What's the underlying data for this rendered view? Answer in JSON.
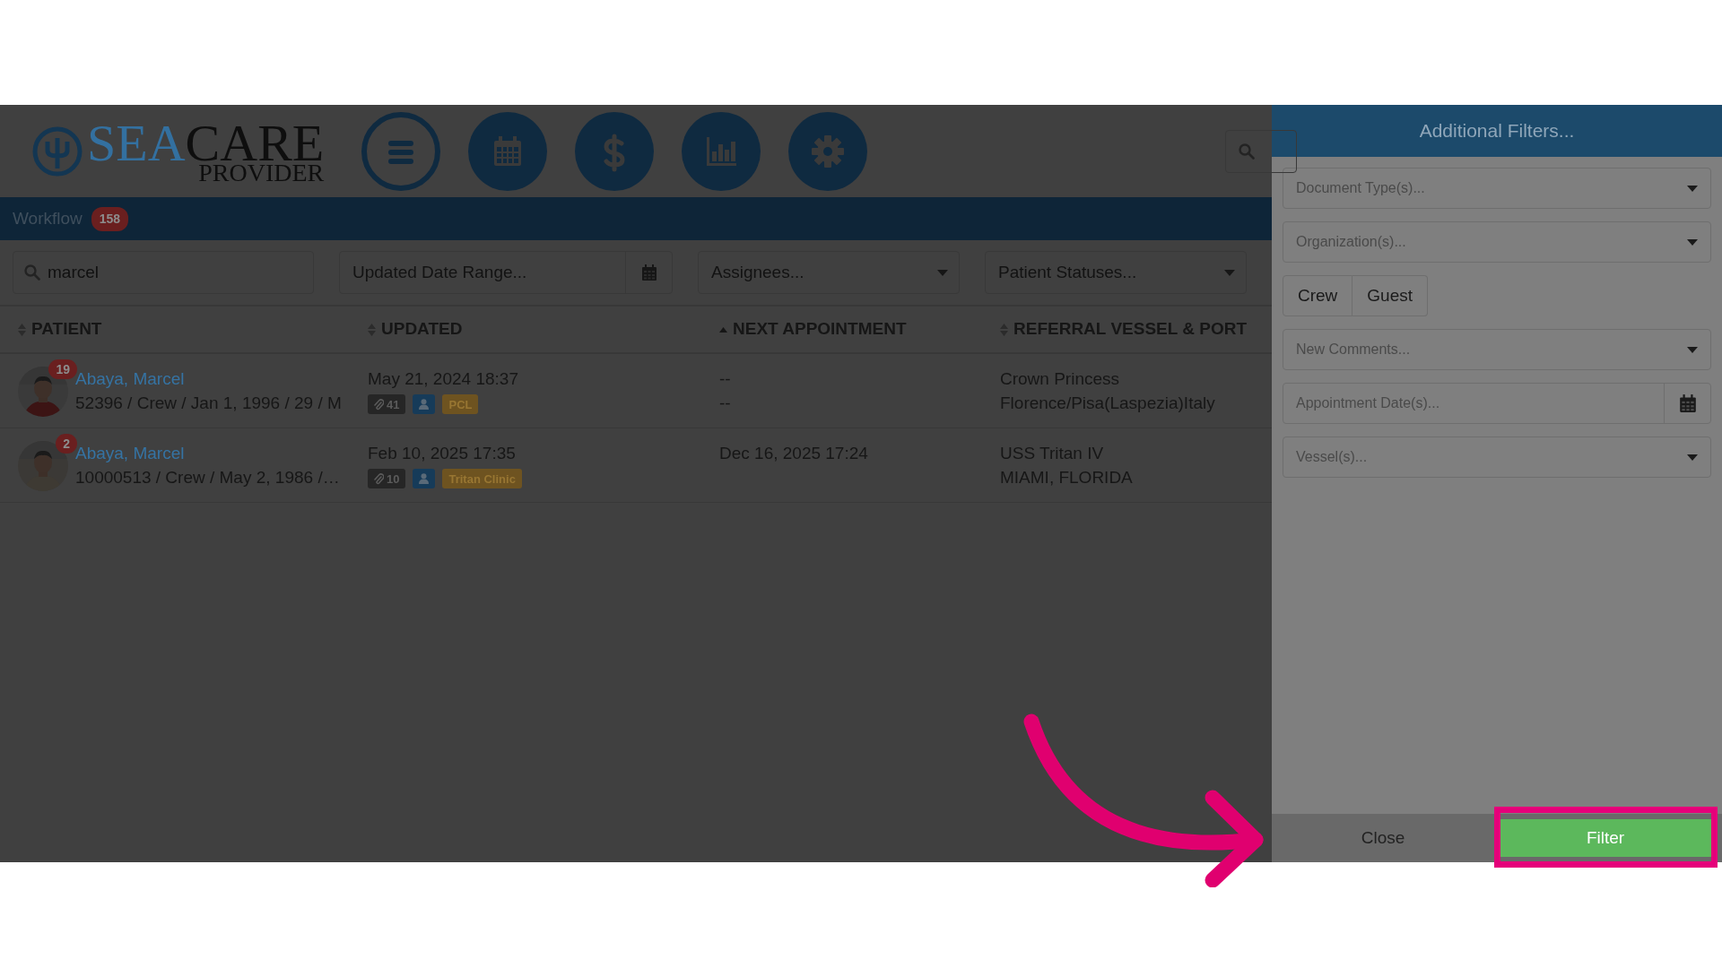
{
  "logo": {
    "primary": "SEA",
    "secondary": "CARE",
    "subtitle": "PROVIDER"
  },
  "nav": [
    {
      "selected": true
    },
    {
      "selected": false
    },
    {
      "selected": false
    },
    {
      "selected": false
    },
    {
      "selected": false
    }
  ],
  "workflow": {
    "label": "Workflow",
    "count": "158"
  },
  "filters": {
    "search": {
      "value": "marcel"
    },
    "date_range": {
      "placeholder": "Updated Date Range..."
    },
    "assignees": {
      "placeholder": "Assignees..."
    },
    "statuses": {
      "placeholder": "Patient Statuses..."
    }
  },
  "table": {
    "columns": [
      {
        "label": "PATIENT",
        "sorted": false
      },
      {
        "label": "UPDATED",
        "sorted": false
      },
      {
        "label": "NEXT APPOINTMENT",
        "sorted": true
      },
      {
        "label": "REFERRAL VESSEL & PORT",
        "sorted": false
      }
    ],
    "rows": [
      {
        "name": "Abaya, Marcel",
        "count": "19",
        "details": "52396 / Crew / Jan 1, 1996 / 29 / M",
        "updated": "May 21, 2024 18:37",
        "attachments": "41",
        "tag": "PCL",
        "appointment": [
          "--",
          "--"
        ],
        "vessel": "Crown Princess",
        "port": "Florence/Pisa(Laspezia)Italy",
        "avatar": {
          "kind": "picture"
        }
      },
      {
        "name": "Abaya, Marcel",
        "count": "2",
        "details": "10000513 / Crew / May 2, 1986 /…",
        "updated": "Feb 10, 2025 17:35",
        "attachments": "10",
        "tag": "Tritan Clinic",
        "appointment": [
          "Dec 16, 2025 17:24"
        ],
        "vessel": "USS Tritan IV",
        "port": "MIAMI, FLORIDA",
        "avatar": {
          "kind": "picture"
        }
      }
    ]
  },
  "panel": {
    "title": "Additional Filters...",
    "fields": [
      {
        "kind": "select",
        "placeholder": "Document Type(s)..."
      },
      {
        "kind": "select",
        "placeholder": "Organization(s)..."
      },
      {
        "kind": "toggle",
        "options": [
          {
            "label": "Crew",
            "selected": false
          },
          {
            "label": "Guest",
            "selected": false
          }
        ]
      },
      {
        "kind": "select",
        "placeholder": "New Comments..."
      },
      {
        "kind": "date",
        "placeholder": "Appointment Date(s)..."
      },
      {
        "kind": "select",
        "placeholder": "Vessel(s)..."
      }
    ],
    "close": "Close",
    "filter": "Filter"
  }
}
